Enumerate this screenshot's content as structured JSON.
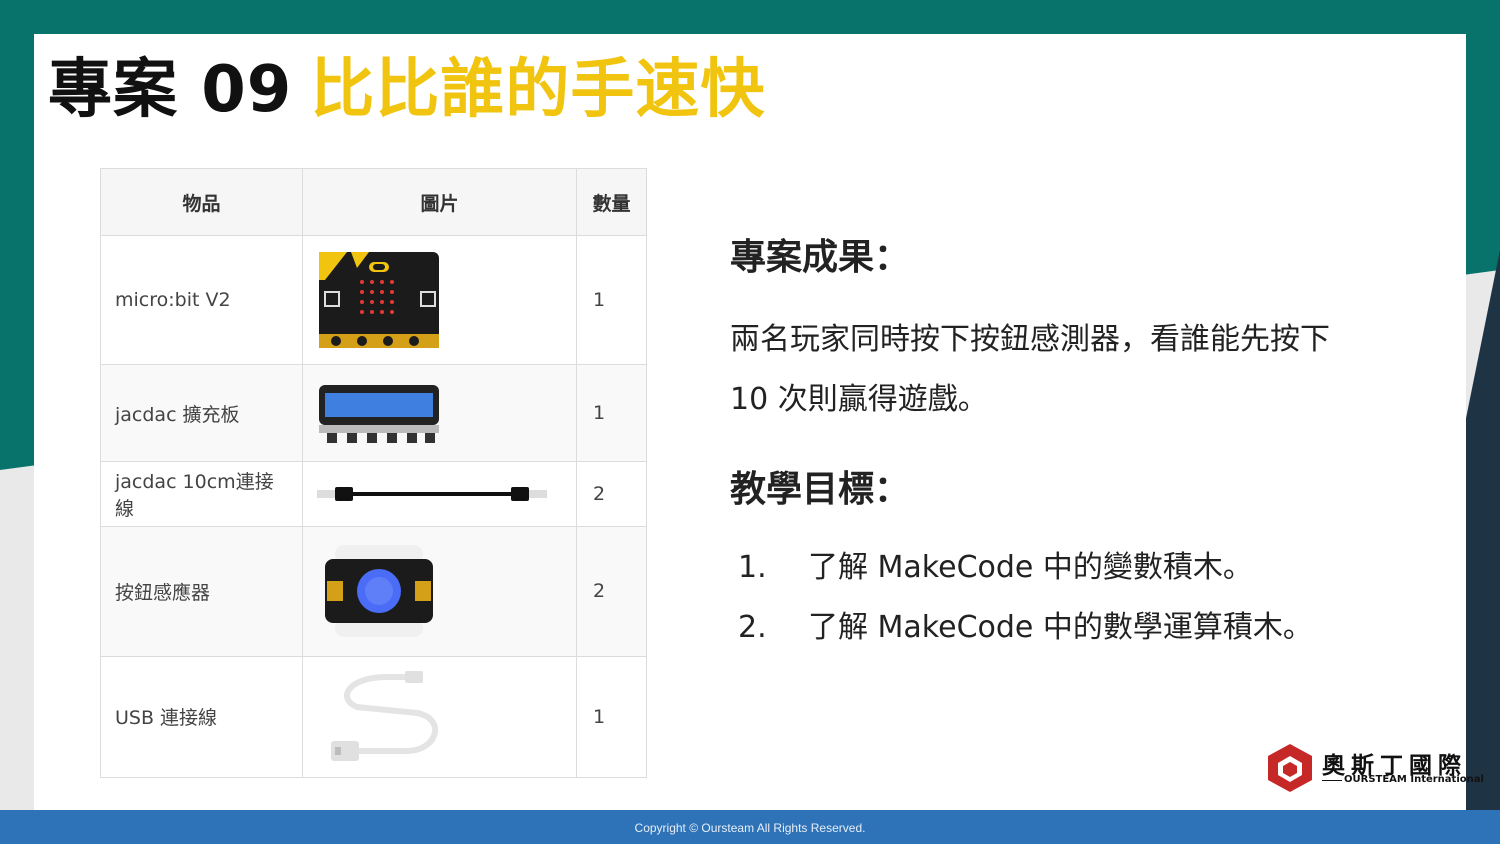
{
  "slide": {
    "title_prefix": "專案 09",
    "title_main": "比比誰的手速快",
    "colors": {
      "teal": "#07736a",
      "accent_yellow": "#f1c40f",
      "navy": "#1e3344",
      "footer_blue": "#2e72b8"
    }
  },
  "table": {
    "headers": [
      "物品",
      "圖片",
      "數量"
    ],
    "rows": [
      {
        "item": "micro:bit V2",
        "image_icon": "microbit-board-icon",
        "qty": "1"
      },
      {
        "item": "jacdac 擴充板",
        "image_icon": "jacdac-expansion-board-icon",
        "qty": "1"
      },
      {
        "item": "jacdac 10cm連接線",
        "image_icon": "jacdac-cable-icon",
        "qty": "2"
      },
      {
        "item": "按鈕感應器",
        "image_icon": "button-sensor-icon",
        "qty": "2"
      },
      {
        "item": "USB 連接線",
        "image_icon": "usb-cable-icon",
        "qty": "1"
      }
    ]
  },
  "result": {
    "heading": "專案成果：",
    "line1": "兩名玩家同時按下按鈕感測器，看誰能先按下",
    "line2": "10 次則贏得遊戲。"
  },
  "goals": {
    "heading": "教學目標：",
    "items": [
      {
        "num": "1.",
        "text": "了解 MakeCode 中的變數積木。"
      },
      {
        "num": "2.",
        "text": "了解 MakeCode 中的數學運算積木。"
      }
    ]
  },
  "logo": {
    "cn": "奧斯丁國際",
    "en": "OURSTEAM International"
  },
  "footer": {
    "copyright": "Copyright © Oursteam All Rights Reserved."
  }
}
